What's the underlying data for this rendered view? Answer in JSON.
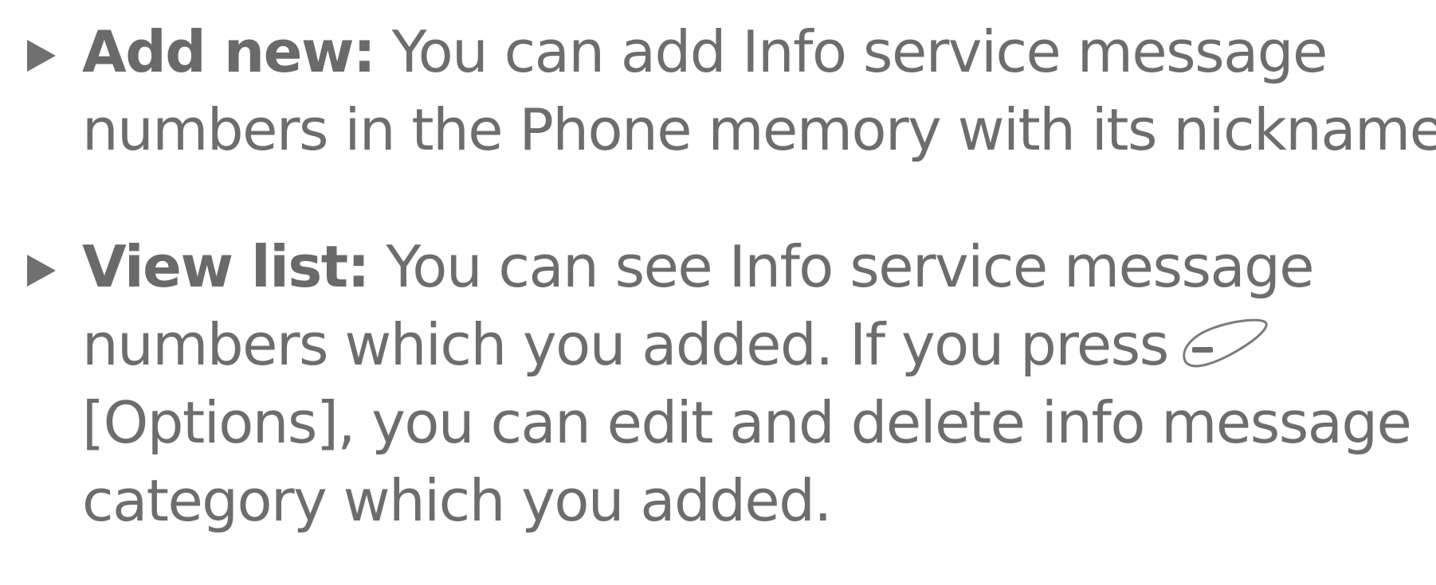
{
  "items": [
    {
      "term": "Add new:",
      "lines": [
        " You can add Info service message",
        "numbers in the Phone memory with its nickname."
      ]
    },
    {
      "term": "View list:",
      "lines": [
        " You can see Info service message",
        "numbers which you added. If you press",
        "[Options], you can edit and delete info message",
        "category which you added."
      ],
      "icon": "left-soft-key-icon"
    }
  ]
}
